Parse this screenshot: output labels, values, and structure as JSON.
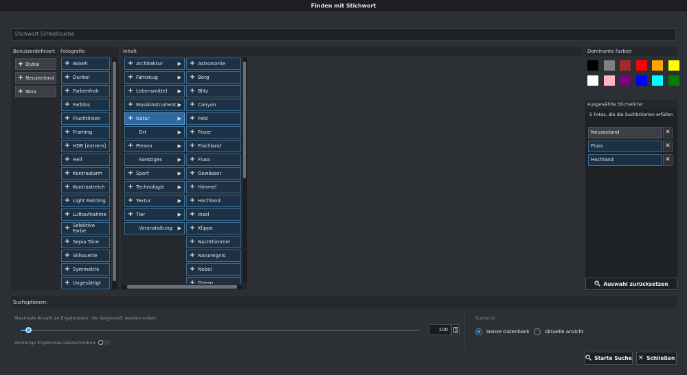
{
  "window": {
    "title": "Finden mit Stichwort"
  },
  "search": {
    "placeholder": "Stichwort Schnellsuche"
  },
  "columns": {
    "custom": {
      "header": "Benutzerdefiniert",
      "items": [
        "Dubai",
        "Neuseeland",
        "Nina"
      ]
    },
    "photo": {
      "header": "Fotografie",
      "items": [
        "Bokeh",
        "Dunkel",
        "Farbenfroh",
        "Farblos",
        "Fluchtlinien",
        "Framing",
        "HDR [extrem]",
        "Hell",
        "Kontrastarm",
        "Kontrastreich",
        "Light Painting",
        "Luftaufnahme",
        "Selektive Farbe",
        "Sepia Töne",
        "Silhouette",
        "Symmetrie",
        "Ungesättigt"
      ]
    },
    "content": {
      "header": "Inhalt",
      "items": [
        {
          "label": "Architektur",
          "plus": true,
          "arrow": true
        },
        {
          "label": "Fahrzeug",
          "plus": true,
          "arrow": true
        },
        {
          "label": "Lebensmittel",
          "plus": true,
          "arrow": true
        },
        {
          "label": "Musikinstrument",
          "plus": true,
          "arrow": true
        },
        {
          "label": "Natur",
          "plus": true,
          "arrow": true,
          "selected": true
        },
        {
          "label": "Ort",
          "plus": false,
          "arrow": true
        },
        {
          "label": "Person",
          "plus": true,
          "arrow": true
        },
        {
          "label": "Sonstiges",
          "plus": false,
          "arrow": true
        },
        {
          "label": "Sport",
          "plus": true,
          "arrow": true
        },
        {
          "label": "Technologie",
          "plus": true,
          "arrow": true
        },
        {
          "label": "Textur",
          "plus": true,
          "arrow": true
        },
        {
          "label": "Tier",
          "plus": true,
          "arrow": true
        },
        {
          "label": "Veranstaltung",
          "plus": false,
          "arrow": true
        }
      ]
    },
    "nature": {
      "items": [
        "Astronomie",
        "Berg",
        "Blitz",
        "Canyon",
        "Feld",
        "Feuer",
        "Flachland",
        "Fluss",
        "Gewässer",
        "Himmel",
        "Hochland",
        "Insel",
        "Klippe",
        "Nachthimmel",
        "Natureignis",
        "Nebel",
        "Ozean"
      ]
    }
  },
  "dominant_colors": {
    "header": "Dominante Farben",
    "swatches": [
      "#000000",
      "#808080",
      "#a52a2a",
      "#ff0000",
      "#ffa500",
      "#ffff00",
      "#ffffff",
      "#ffb6c1",
      "#800080",
      "#0000ff",
      "#00ffff",
      "#008000"
    ]
  },
  "selected_keywords": {
    "header": "Ausgewählte Stichwörter",
    "result_text": "5 Fotos, die die Suchkriterien erfüllen",
    "items": [
      {
        "label": "Neuseeland",
        "style": "grey"
      },
      {
        "label": "Fluss",
        "style": "blue"
      },
      {
        "label": "Hochland",
        "style": "blue"
      }
    ],
    "reset_label": "Auswahl zurücksetzen"
  },
  "options": {
    "header": "Suchoptionen:",
    "max_results_label": "Maximale Anzahl an Ergebnissen, die dargestellt werden sollen:",
    "max_results_value": "100",
    "slider_fraction": 0.02,
    "overwrite_label": "Vorherige Ergebnisse überschreiben:",
    "search_in_label": "Suche in:",
    "radio": [
      {
        "label": "Ganze Datenbank",
        "checked": true
      },
      {
        "label": "Aktuelle Ansicht",
        "checked": false
      }
    ]
  },
  "buttons": {
    "start": "Starte Suche",
    "close": "Schließen"
  }
}
